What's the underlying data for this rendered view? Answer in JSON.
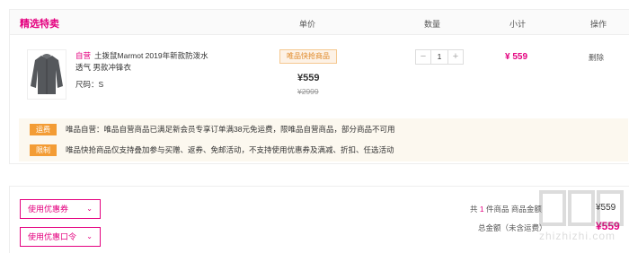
{
  "header": {
    "title": "精选特卖",
    "col_price": "单价",
    "col_qty": "数量",
    "col_subtotal": "小计",
    "col_action": "操作"
  },
  "item": {
    "self_tag": "自营",
    "name": "土拨鼠Marmot 2019年新款防泼水透气 男款冲锋衣",
    "size": "尺码：S",
    "badge": "唯品快抢商品",
    "price": "¥559",
    "original_price": "¥2999",
    "qty_minus": "−",
    "qty_value": "1",
    "qty_plus": "+",
    "subtotal": "¥ 559",
    "delete": "删除"
  },
  "notes": [
    {
      "tag": "运费",
      "text": "唯品自营：唯品自营商品已满足新会员专享订单满38元免运费，限唯品自营商品，部分商品不可用"
    },
    {
      "tag": "限制",
      "text": "唯品快抢商品仅支持叠加参与买赠、返券、免邮活动，不支持使用优惠券及满减、折扣、任选活动"
    }
  ],
  "footer": {
    "coupon_button": "使用优惠券",
    "code_button": "使用优惠口令",
    "count_prefix": "共",
    "count": "1",
    "count_suffix": "件商品",
    "goods_label": "商品金额",
    "goods_amount": "¥559",
    "total_label": "总金额（未含运费）",
    "total_amount": "¥559"
  },
  "watermark": {
    "text": "zhizhizhi.com"
  },
  "colors": {
    "brand": "#e4007f",
    "tag_orange": "#f39c35",
    "note_bg": "#fcf8ef"
  }
}
